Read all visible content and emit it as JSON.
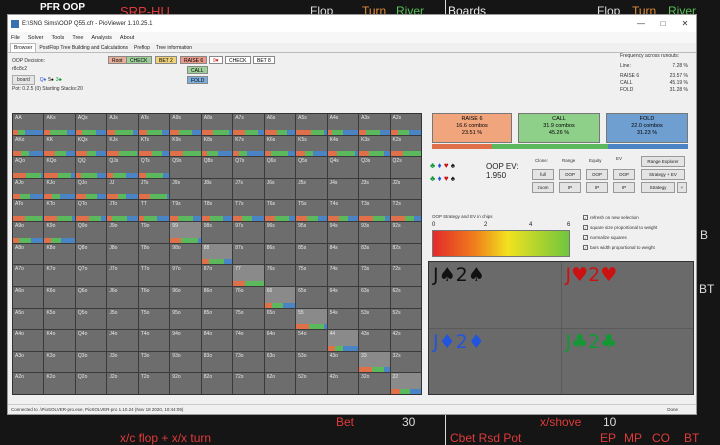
{
  "background": {
    "pfr_oop": "PFR OOP",
    "srp_hu": "SRP-HU",
    "flop": "Flop",
    "turn": "Turn",
    "river": "River",
    "boards": "Boards",
    "flop2": "Flop",
    "turn2": "Turn",
    "river2": "River",
    "bet": "Bet",
    "bet_value": "30",
    "x_shove": "x/shove",
    "x_shove_value": "10",
    "xc_line": "x/c flop + x/x turn",
    "cbet": "Cbet Rsd Pot",
    "ep": "EP",
    "mp": "MP",
    "co": "CO",
    "bt": "BT",
    "right_b1": "B",
    "right_b2": "BT"
  },
  "window": {
    "title": "E:\\SNG Sims\\OOP Q55.cfr - PioViewer 1.10.25.1",
    "menu": [
      "File",
      "Solver",
      "Tools",
      "Tree",
      "Analysis",
      "About"
    ],
    "tabs": [
      "Browser",
      "PostFlop Tree Building and Calculations",
      "Preflop",
      "Tree information"
    ],
    "status": "Connected to .\\PioSOLVER-pro.exe, PioSOLVER-pro 1.10.24 (Nov 18 2020, 10:44:09)",
    "status_done": "Done"
  },
  "left_panel": {
    "decision": "OOP Decision:",
    "board_cards": "r8c8c2",
    "board_button": "board",
    "board_q": "Q♦",
    "board_5": "5♠",
    "board_3": "3♣",
    "pot": "Pot: 0.2.5 (0) Starting Stacks:20"
  },
  "tree": {
    "root": "Root",
    "check": "CHECK",
    "bet2": "BET 2",
    "raise6": "RAISE 6",
    "nine": "9♥",
    "check2": "CHECK",
    "bet8": "BET 8",
    "call": "CALL",
    "fold": "FOLD"
  },
  "freq": {
    "title": "Frequency across runouts:",
    "line_label": "Line:",
    "line_val": "7.28 %",
    "rows": [
      {
        "label": "RAISE 6",
        "val": "23.57 %"
      },
      {
        "label": "CALL",
        "val": "45.19 %"
      },
      {
        "label": "FOLD",
        "val": "31.28 %"
      }
    ]
  },
  "grid": {
    "hands": [
      "AA",
      "AKs",
      "AQs",
      "AJs",
      "ATs",
      "A9s",
      "A8s",
      "A7s",
      "A6s",
      "A5s",
      "A4s",
      "A3s",
      "A2s",
      "AKo",
      "KK",
      "KQs",
      "KJs",
      "KTs",
      "K9s",
      "K8s",
      "K7s",
      "K6s",
      "K5s",
      "K4s",
      "K3s",
      "K2s",
      "AQo",
      "KQo",
      "QQ",
      "QJs",
      "QTs",
      "Q9s",
      "Q8s",
      "Q7s",
      "Q6s",
      "Q5s",
      "Q4s",
      "Q3s",
      "Q2s",
      "AJo",
      "KJo",
      "QJo",
      "JJ",
      "JTs",
      "J9s",
      "J8s",
      "J7s",
      "J6s",
      "J5s",
      "J4s",
      "J3s",
      "J2s",
      "ATo",
      "KTo",
      "QTo",
      "JTo",
      "TT",
      "T9s",
      "T8s",
      "T7s",
      "T6s",
      "T5s",
      "T4s",
      "T3s",
      "T2s",
      "A9o",
      "K9o",
      "Q9o",
      "J9o",
      "T9o",
      "99",
      "98s",
      "97s",
      "96s",
      "95s",
      "94s",
      "93s",
      "92s",
      "A8o",
      "K8o",
      "Q8o",
      "J8o",
      "T8o",
      "98o",
      "88",
      "87s",
      "86s",
      "85s",
      "84s",
      "83s",
      "82s",
      "A7o",
      "K7o",
      "Q7o",
      "J7o",
      "T7o",
      "97o",
      "87o",
      "77",
      "76s",
      "75s",
      "74s",
      "73s",
      "72s",
      "A6o",
      "K6o",
      "Q6o",
      "J6o",
      "T6o",
      "96o",
      "86o",
      "76o",
      "66",
      "65s",
      "64s",
      "63s",
      "62s",
      "A5o",
      "K5o",
      "Q5o",
      "J5o",
      "T5o",
      "95o",
      "85o",
      "75o",
      "65o",
      "55",
      "54s",
      "53s",
      "52s",
      "A4o",
      "K4o",
      "Q4o",
      "J4o",
      "T4o",
      "94o",
      "84o",
      "74o",
      "64o",
      "54o",
      "44",
      "43s",
      "42s",
      "A3o",
      "K3o",
      "Q3o",
      "J3o",
      "T3o",
      "93o",
      "83o",
      "73o",
      "63o",
      "53o",
      "43o",
      "33",
      "32s",
      "A2o",
      "K2o",
      "Q2o",
      "J2o",
      "T2o",
      "92o",
      "82o",
      "72o",
      "62o",
      "52o",
      "42o",
      "32o",
      "22"
    ]
  },
  "actions": [
    {
      "name": "RAISE 6",
      "combos": "16.6 combos",
      "pct": "23.51 %",
      "color": "#f0a57d"
    },
    {
      "name": "CALL",
      "combos": "31.9 combos",
      "pct": "45.26 %",
      "color": "#8ecf8a"
    },
    {
      "name": "FOLD",
      "combos": "22.0 combos",
      "pct": "31.23 %",
      "color": "#6f9fd0"
    }
  ],
  "controls": {
    "clone": "Clone:",
    "range": "Range",
    "equity": "Equity",
    "ev": "EV",
    "full": "full",
    "zoom": "zoom",
    "oop1": "OOP",
    "ip1": "IP",
    "oop2": "OOP",
    "ip2": "IP",
    "oop3": "OOP",
    "ip3": "IP",
    "range_explorer": "Range Explorer",
    "strategy_ev": "Strategy + EV",
    "strategy": "Strategy",
    "plus": "+",
    "oop_ev_label": "OOP EV:",
    "oop_ev_value": "1.950",
    "strategy_hdr": "OOP Strategy and EV in chips",
    "scale": [
      "0",
      "2",
      "4",
      "6"
    ],
    "checks": [
      "refresh on new selection",
      "square size proportional to weight",
      "normalize squares",
      "bars width proportional to weight"
    ]
  },
  "combos": [
    {
      "rank": "J",
      "suit": "♠",
      "rank2": "2",
      "suit2": "♠",
      "color": "#111111"
    },
    {
      "rank": "J",
      "suit": "♥",
      "rank2": "2",
      "suit2": "♥",
      "color": "#cc1111"
    },
    {
      "rank": "J",
      "suit": "♦",
      "rank2": "2",
      "suit2": "♦",
      "color": "#2255dd"
    },
    {
      "rank": "J",
      "suit": "♣",
      "rank2": "2",
      "suit2": "♣",
      "color": "#119933"
    }
  ]
}
